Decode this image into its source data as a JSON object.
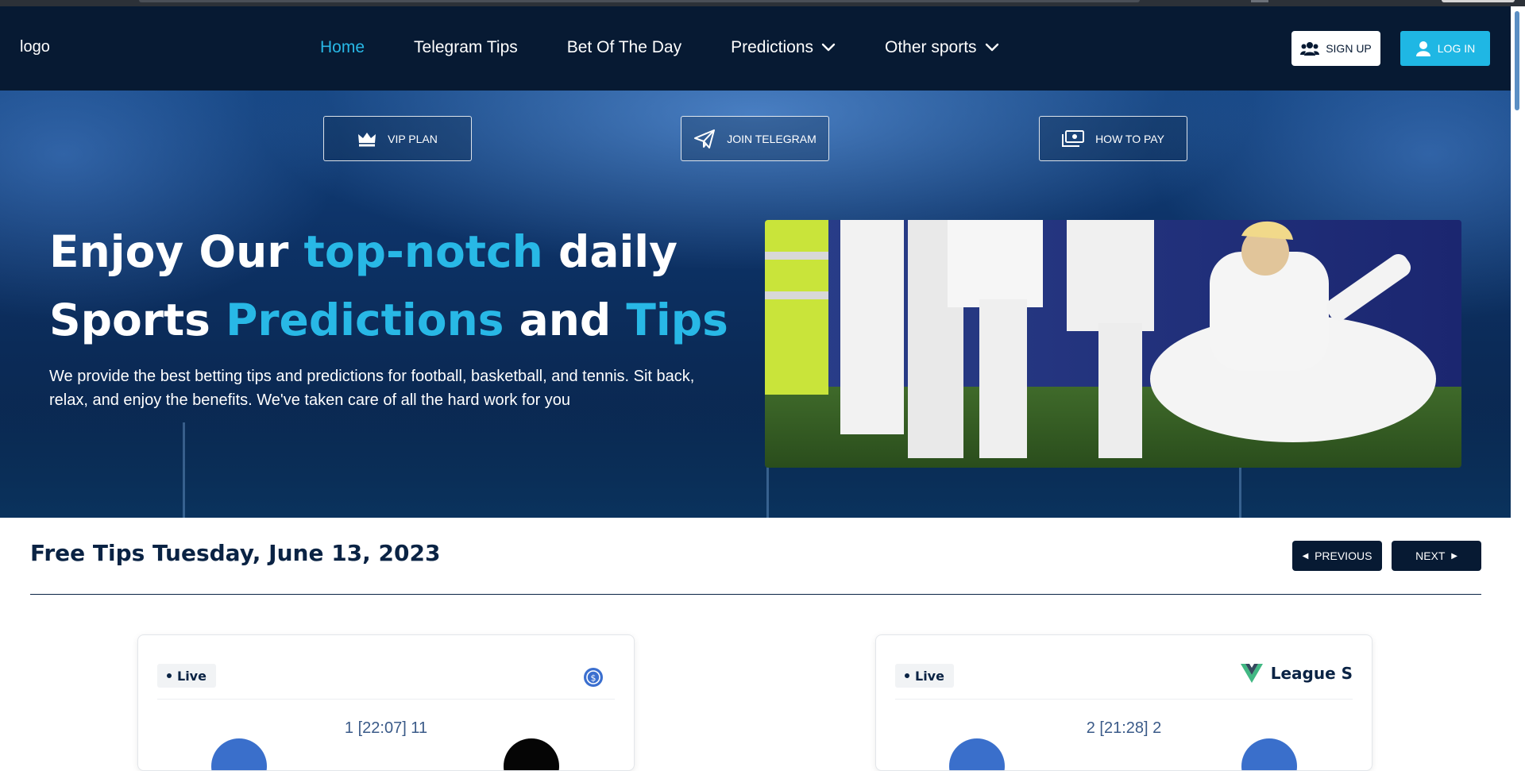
{
  "navbar": {
    "logo": "logo",
    "links": [
      {
        "label": "Home",
        "active": true
      },
      {
        "label": "Telegram Tips"
      },
      {
        "label": "Bet Of The Day"
      },
      {
        "label": "Predictions",
        "dropdown": true
      },
      {
        "label": "Other sports",
        "dropdown": true
      }
    ],
    "signup_label": "SIGN UP",
    "login_label": "LOG IN"
  },
  "hero": {
    "buttons": [
      {
        "label": "VIP PLAN",
        "icon": "crown-icon"
      },
      {
        "label": "JOIN TELEGRAM",
        "icon": "paper-plane-icon"
      },
      {
        "label": "HOW TO PAY",
        "icon": "money-icon"
      }
    ],
    "heading": {
      "w1": "Enjoy Our ",
      "w2": "top-notch",
      "w3": " daily",
      "w4": "Sports ",
      "w5": "Predictions",
      "w6": " and ",
      "w7": "Tips"
    },
    "description": "We provide the best betting tips and predictions for football, basketball, and tennis. Sit back, relax, and enjoy the benefits. We've taken care of all the hard work for you"
  },
  "tips": {
    "title": "Free Tips Tuesday, June 13, 2023",
    "prev_label": "PREVIOUS",
    "next_label": "NEXT",
    "cards": [
      {
        "status": "Live",
        "score": "1 [22:07] 11",
        "league": ""
      },
      {
        "status": "Live",
        "score": "2 [21:28] 2",
        "league": "League S"
      }
    ]
  },
  "colors": {
    "navy": "#071a33",
    "accent": "#28b8e6",
    "login_button": "#1fb7e4"
  }
}
